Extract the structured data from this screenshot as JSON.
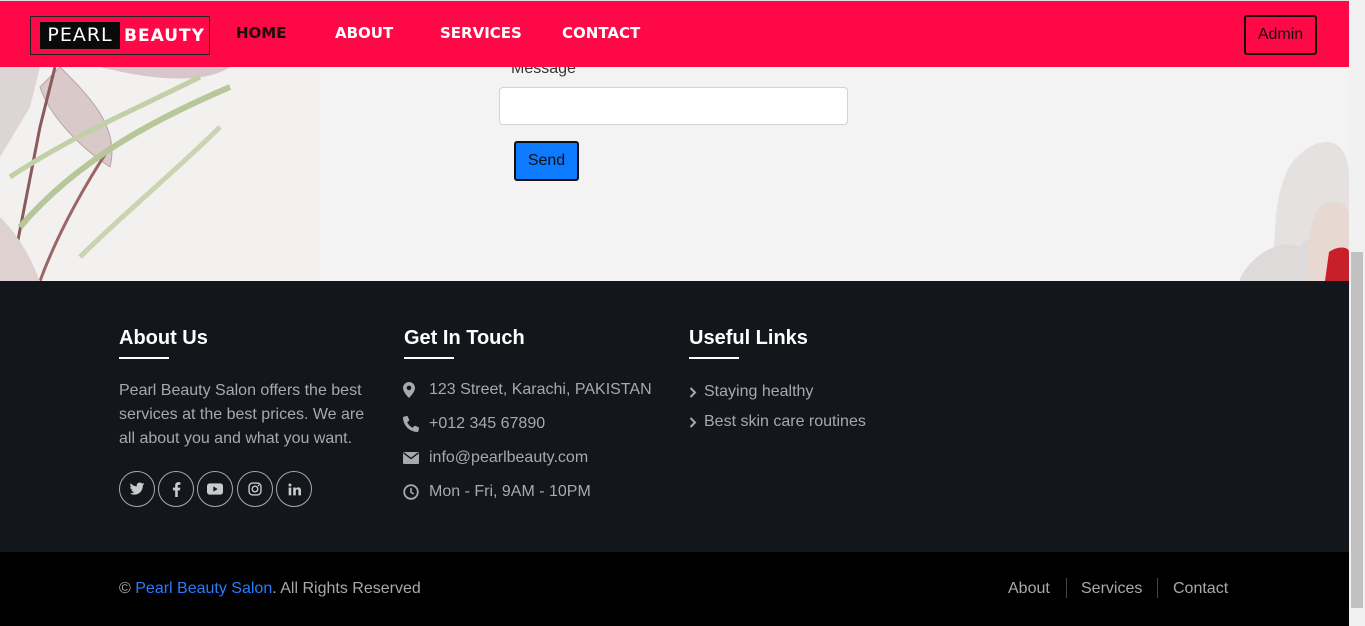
{
  "brand": {
    "pearl": "PEARL",
    "beauty": "BEAUTY"
  },
  "nav": {
    "home": "HOME",
    "about": "ABOUT",
    "services": "SERVICES",
    "contact": "CONTACT",
    "admin": "Admin"
  },
  "form": {
    "message_label": "Message",
    "message_value": "",
    "send_label": "Send"
  },
  "footer": {
    "about": {
      "title": "About Us",
      "text": "Pearl Beauty Salon offers the best services at the best prices. We are all about you and what you want.",
      "social": [
        "twitter-icon",
        "facebook-icon",
        "youtube-icon",
        "instagram-icon",
        "linkedin-icon"
      ]
    },
    "touch": {
      "title": "Get In Touch",
      "address": "123 Street, Karachi, PAKISTAN",
      "phone": "+012 345 67890",
      "email": "info@pearlbeauty.com",
      "hours": "Mon - Fri, 9AM - 10PM"
    },
    "links": {
      "title": "Useful Links",
      "items": [
        "Staying healthy",
        "Best skin care routines"
      ]
    }
  },
  "bottom": {
    "copy_symbol": "©",
    "brand_link": "Pearl Beauty Salon",
    "rights": ". All Rights Reserved",
    "links": [
      "About",
      "Services",
      "Contact"
    ]
  },
  "colors": {
    "navbar": "#ff0848",
    "footer": "#13161a",
    "bottom_bar": "#000000",
    "send_button": "#0d7bff",
    "link_blue": "#2b7bff"
  }
}
